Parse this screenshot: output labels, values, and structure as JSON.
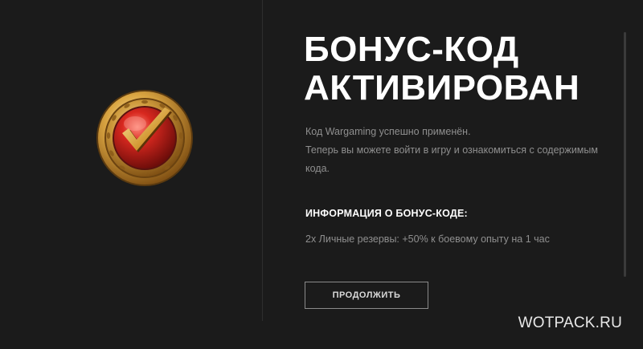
{
  "dialog": {
    "title_line1": "БОНУС-КОД",
    "title_line2": "АКТИВИРОВАН",
    "description_line1": "Код Wargaming успешно применён.",
    "description_line2": "Теперь вы можете войти в игру и ознакомиться с содержимым кода.",
    "info_heading": "ИНФОРМАЦИЯ О БОНУС-КОДЕ:",
    "info_item": "2x Личные резервы: +50% к боевому опыту на 1 час",
    "continue_label": "ПРОДОЛЖИТЬ"
  },
  "badge": {
    "icon": "checkmark-medal-icon"
  },
  "watermark": {
    "text": "WOTPACK.RU"
  },
  "colors": {
    "background": "#1b1b1b",
    "title": "#ffffff",
    "body_text": "#8f8f8f",
    "badge_gold": "#c8922e",
    "badge_red": "#c0201b"
  }
}
